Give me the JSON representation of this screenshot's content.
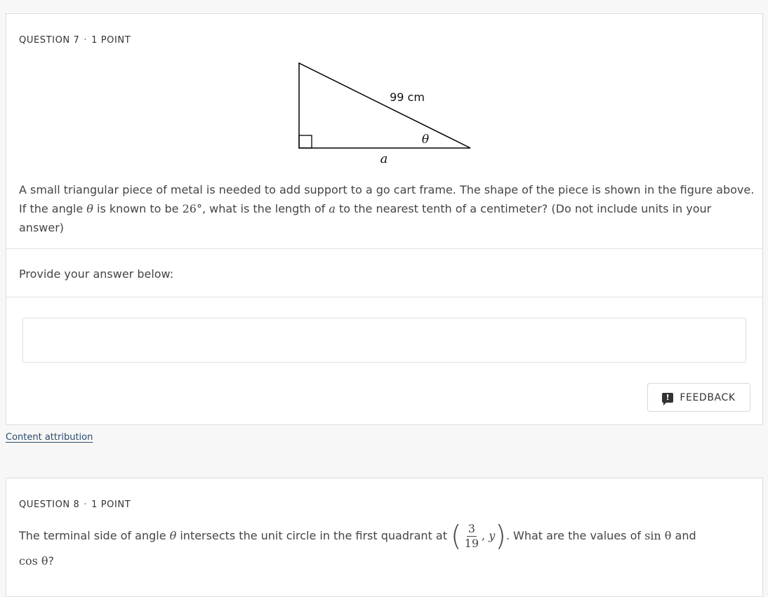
{
  "q7": {
    "label": "QUESTION 7",
    "points": "1 POINT",
    "figure": {
      "hypotenuse_label": "99 cm",
      "angle_label": "θ",
      "side_label": "a"
    },
    "text_1": "A small triangular piece of metal is needed to add support to a go cart frame. The shape of the piece is shown in the figure above. If the angle ",
    "theta": "θ",
    "text_2": " is known to be ",
    "angle_value": "26°",
    "text_3": ", what is the length of ",
    "var_a": "a",
    "text_4": " to the nearest tenth of a centimeter? (Do not include units in your answer)",
    "prompt": "Provide your answer below:",
    "answer_value": "",
    "feedback_label": "FEEDBACK"
  },
  "attribution": "Content attribution",
  "q8": {
    "label": "QUESTION 8",
    "points": "1 POINT",
    "text_1": "The terminal side of angle ",
    "theta": "θ",
    "text_2": " intersects the unit circle in the first quadrant at ",
    "frac_num": "3",
    "frac_den": "19",
    "coord_y": "y",
    "text_3": ". What are the values of ",
    "sin_theta": "sin θ",
    "text_4": " and",
    "cos_theta": "cos θ",
    "text_5": "?"
  }
}
